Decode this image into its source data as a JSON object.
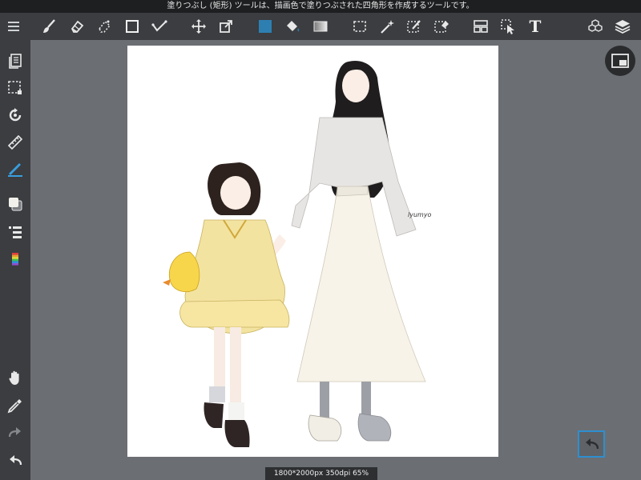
{
  "status_bar": {
    "message": "塗りつぶし (矩形) ツールは、描画色で塗りつぶされた四角形を作成するツールです。"
  },
  "colors": {
    "current_color": "#2e7fb1",
    "toolbar_bg": "#3b3d40",
    "workspace_bg": "#6b6e73",
    "highlight": "#2e8fd0"
  },
  "toolbar": {
    "items": [
      {
        "icon": "menu-icon"
      },
      {
        "icon": "brush-icon"
      },
      {
        "icon": "eraser-icon"
      },
      {
        "icon": "soft-eraser-icon"
      },
      {
        "icon": "rectangle-fill-icon"
      },
      {
        "icon": "stroke-icon"
      },
      {
        "icon": "move-icon"
      },
      {
        "icon": "transform-icon"
      },
      {
        "icon": "color-swatch-icon"
      },
      {
        "icon": "bucket-icon"
      },
      {
        "icon": "gradient-icon"
      },
      {
        "icon": "select-rect-icon"
      },
      {
        "icon": "magic-wand-icon"
      },
      {
        "icon": "select-pen-icon"
      },
      {
        "icon": "select-eraser-icon"
      },
      {
        "icon": "frame-icon"
      },
      {
        "icon": "operation-icon"
      },
      {
        "icon": "text-icon"
      },
      {
        "icon": "material-icon"
      },
      {
        "icon": "layers-icon"
      }
    ],
    "text_tool_glyph": "T"
  },
  "sidebar": {
    "items": [
      {
        "icon": "pages-icon"
      },
      {
        "icon": "selection-icon"
      },
      {
        "icon": "rotate-icon"
      },
      {
        "icon": "ruler-icon"
      },
      {
        "icon": "pen-icon"
      },
      {
        "icon": "color-icon"
      },
      {
        "icon": "layer-list-icon"
      },
      {
        "icon": "rainbow-palette-icon"
      },
      {
        "icon": "hand-icon"
      },
      {
        "icon": "eyedropper-icon"
      },
      {
        "icon": "redo-icon"
      },
      {
        "icon": "undo-icon"
      }
    ]
  },
  "canvas": {
    "info": "1800*2000px 350dpi 65%"
  },
  "artwork": {
    "signature": "lyumyo"
  }
}
